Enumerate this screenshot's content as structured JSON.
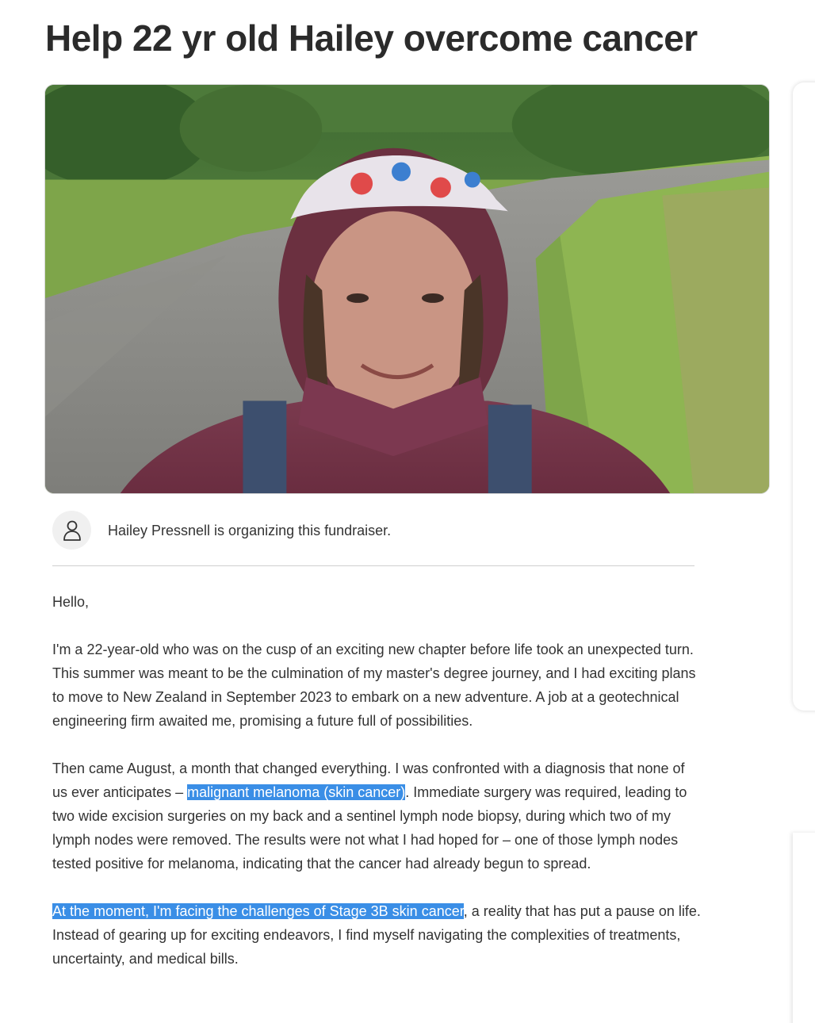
{
  "title": "Help 22 yr old Hailey overcome cancer",
  "organizer": {
    "text": "Hailey Pressnell is organizing this fundraiser.",
    "icon": "person-icon"
  },
  "story": {
    "greeting": "Hello,",
    "p1": "I'm a 22-year-old who was on the cusp of an exciting new chapter before life took an unexpected turn. This summer was meant to be the culmination of my master's degree journey, and I had exciting plans to move to New Zealand in September 2023 to embark on a new adventure. A job at a geotechnical engineering firm awaited me, promising a future full of possibilities.",
    "p2_before": "Then came August, a month that changed everything. I was confronted with a diagnosis that none of us ever anticipates – ",
    "p2_highlight": "malignant melanoma (skin cancer)",
    "p2_after": ". Immediate surgery was required, leading to two wide excision surgeries on my back and a sentinel lymph node biopsy, during which two of my lymph nodes were removed. The results were not what I had hoped for – one of those lymph nodes tested positive for melanoma, indicating that the cancer had already begun to spread.",
    "p3_highlight": "At the moment, I'm facing the challenges of Stage 3B skin cancer",
    "p3_after": ", a reality that has put a pause on life. Instead of gearing up for exciting endeavors, I find myself navigating the complexities of treatments, uncertainty, and medical bills."
  },
  "colors": {
    "highlight": "#3a8ee6",
    "title": "#2b2b2b",
    "body_text": "#333333"
  }
}
